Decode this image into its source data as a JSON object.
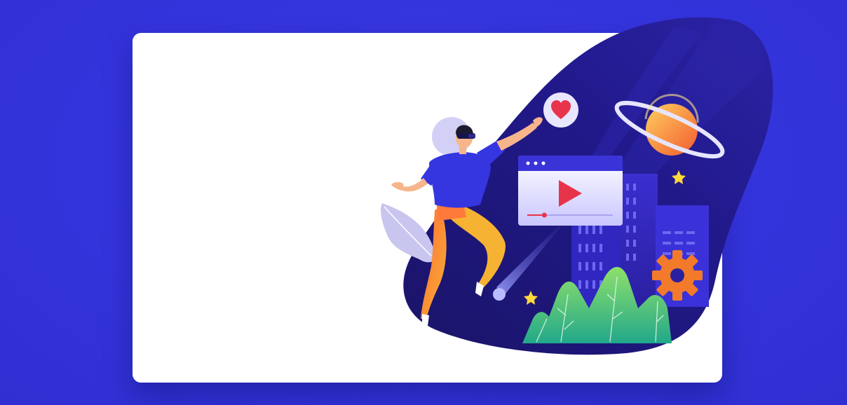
{
  "colors": {
    "background": "#3434dc",
    "card": "#ffffff",
    "blob_dark": "#1a1468",
    "blob_mid": "#231a86",
    "accent_heart": "#e8344a",
    "accent_planet": "#f7813a",
    "plant_green": "#3fc07a",
    "gear_orange": "#f27a2a",
    "star_yellow": "#ffd83a"
  },
  "illustration": {
    "subject": "person-with-vr-headset",
    "icons": [
      "heart-icon",
      "planet-icon",
      "video-player-icon",
      "play-icon",
      "gear-icon",
      "star-icon",
      "building-icon",
      "plant-icon",
      "leaf-icon",
      "meteor-icon"
    ]
  },
  "video_player": {
    "progress": 0.2
  }
}
